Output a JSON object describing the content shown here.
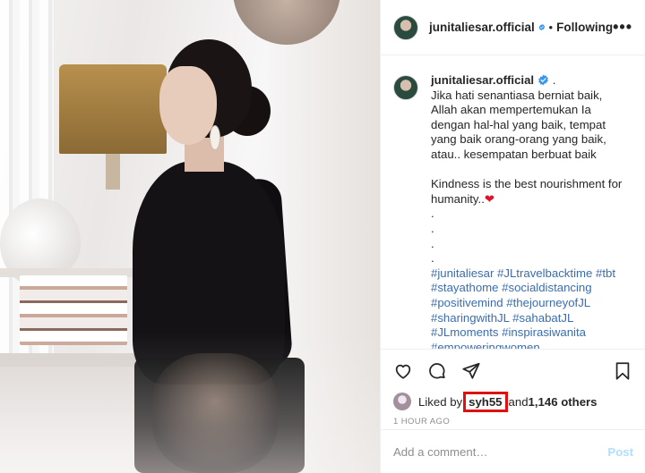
{
  "header": {
    "username": "junitaliesar.official",
    "separator": "•",
    "follow_status": "Following",
    "more_label": "•••"
  },
  "caption": {
    "username": "junitaliesar.official",
    "suffix": " .",
    "text": "Jika hati senantiasa berniat baik,\nAllah akan mempertemukan Ia\ndengan hal-hal yang baik, tempat\nyang baik orang-orang yang baik,\natau.. kesempatan berbuat baik\n\nKindness is the best nourishment for\nhumanity..",
    "heart": "❤",
    "dots": ".\n.\n.\n.",
    "hashtags": "#junitaliesar #JLtravelbacktime #tbt\n#stayathome #socialdistancing\n#positivemind #thejourneyofJL\n#sharingwithJL #sahabatJL\n#JLmoments #inspirasiwanita\n#empoweringwomen\n#inspirationalwomen #JLxdinamich"
  },
  "likes": {
    "prefix": "Liked by ",
    "user": "syh55",
    "middle": " and ",
    "others": "1,146 others"
  },
  "timestamp": "1 HOUR AGO",
  "comment": {
    "placeholder": "Add a comment…",
    "post_label": "Post"
  },
  "colors": {
    "verified": "#3897f0",
    "hashtag": "#3a6db0",
    "highlight": "#e01010",
    "post_button": "#b2dffc"
  },
  "icons": [
    "verified-badge-icon",
    "heart-icon",
    "comment-icon",
    "share-icon",
    "bookmark-icon",
    "more-options-icon"
  ]
}
